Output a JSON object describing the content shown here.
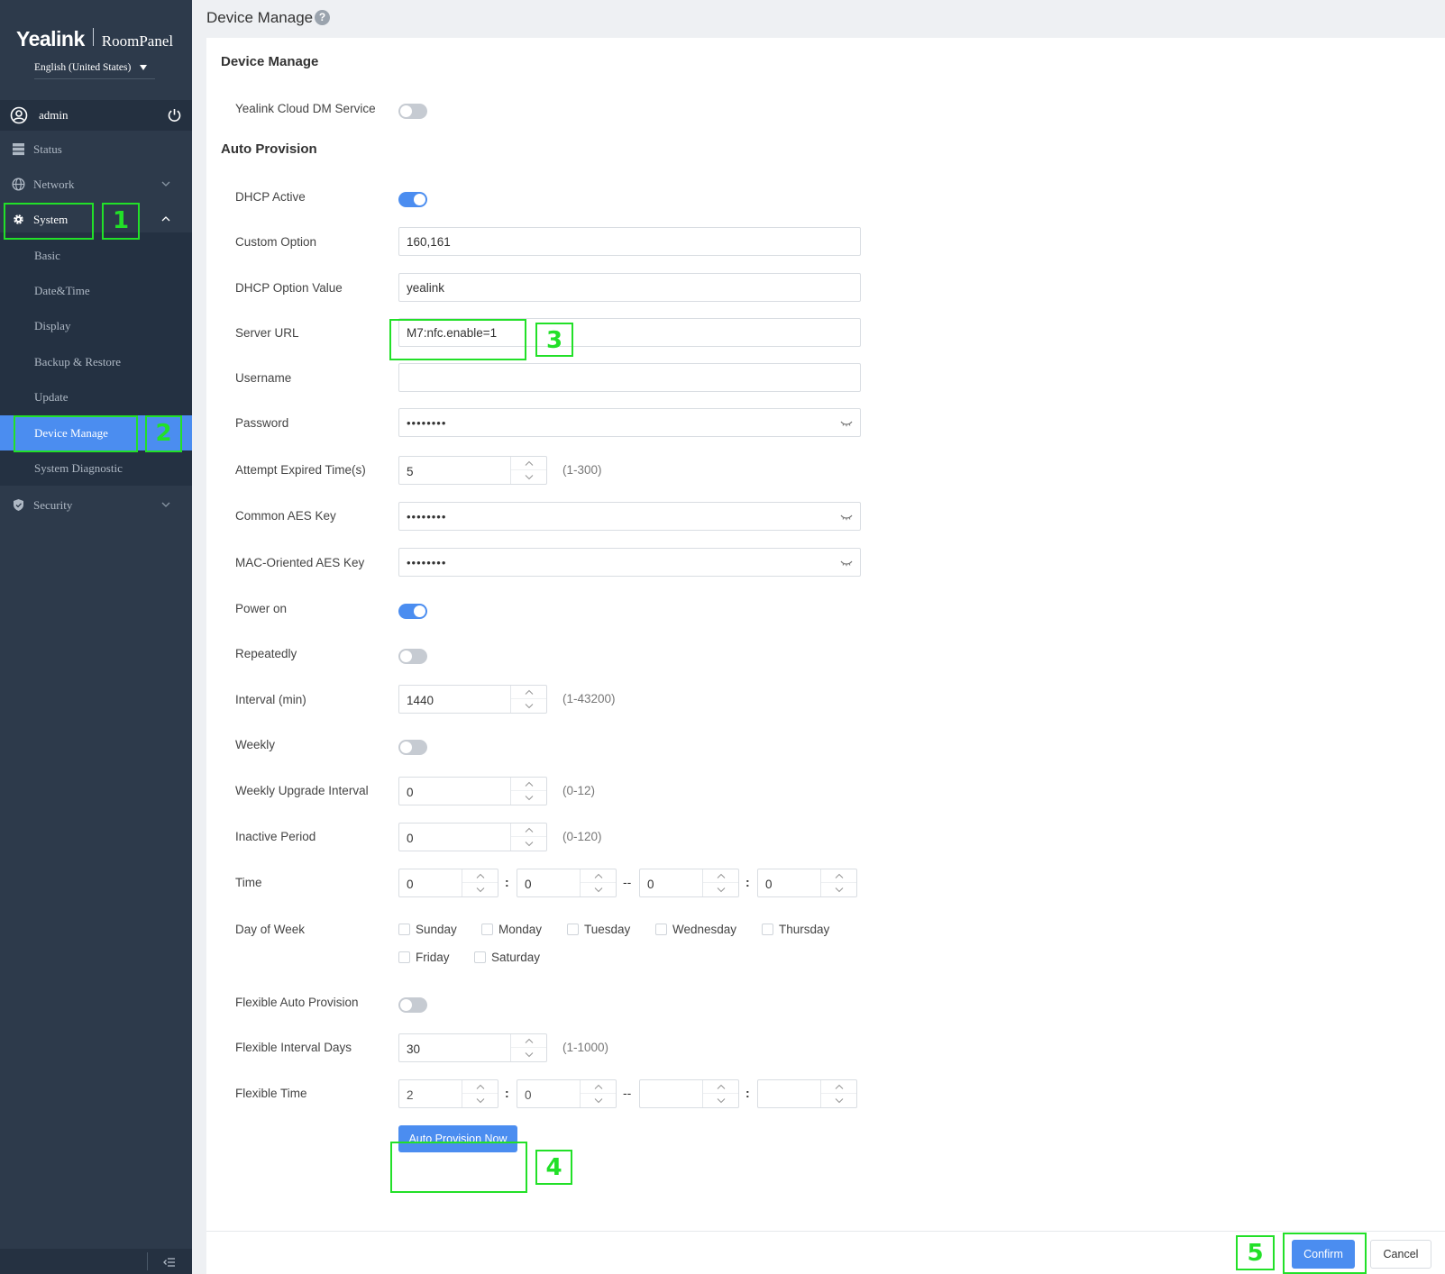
{
  "brand": {
    "logo": "Yealink",
    "product": "RoomPanel"
  },
  "language": {
    "selected": "English (United States)"
  },
  "user": {
    "name": "admin"
  },
  "sidebar": {
    "items": [
      {
        "label": "Status",
        "icon": "server-icon"
      },
      {
        "label": "Network",
        "icon": "globe-icon"
      },
      {
        "label": "System",
        "icon": "gear-icon"
      },
      {
        "label": "Security",
        "icon": "shield-icon"
      }
    ],
    "system_sub": [
      {
        "label": "Basic"
      },
      {
        "label": "Date&Time"
      },
      {
        "label": "Display"
      },
      {
        "label": "Backup & Restore"
      },
      {
        "label": "Update"
      },
      {
        "label": "Device Manage",
        "selected": true
      },
      {
        "label": "System Diagnostic"
      }
    ]
  },
  "header": {
    "title": "Device Manage",
    "help": "?"
  },
  "device_manage": {
    "section_title": "Device Manage",
    "cloud_dm_label": "Yealink Cloud DM Service",
    "cloud_dm_on": false
  },
  "auto_provision": {
    "section_title": "Auto Provision",
    "dhcp_active_label": "DHCP Active",
    "dhcp_active_on": true,
    "custom_option_label": "Custom Option",
    "custom_option_value": "160,161",
    "dhcp_option_value_label": "DHCP Option Value",
    "dhcp_option_value": "yealink",
    "server_url_label": "Server URL",
    "server_url_value": "M7:nfc.enable=1",
    "username_label": "Username",
    "username_value": "",
    "password_label": "Password",
    "password_mask": "••••••••",
    "attempt_label": "Attempt Expired Time(s)",
    "attempt_value": "5",
    "attempt_range": "(1-300)",
    "common_aes_label": "Common AES Key",
    "common_aes_mask": "••••••••",
    "mac_aes_label": "MAC-Oriented AES Key",
    "mac_aes_mask": "••••••••",
    "power_on_label": "Power on",
    "power_on_on": true,
    "repeatedly_label": "Repeatedly",
    "repeatedly_on": false,
    "interval_label": "Interval (min)",
    "interval_value": "1440",
    "interval_range": "(1-43200)",
    "weekly_label": "Weekly",
    "weekly_on": false,
    "weekly_upgrade_label": "Weekly Upgrade Interval",
    "weekly_upgrade_value": "0",
    "weekly_upgrade_range": "(0-12)",
    "inactive_label": "Inactive Period",
    "inactive_value": "0",
    "inactive_range": "(0-120)",
    "time_label": "Time",
    "time_values": [
      "0",
      "0",
      "0",
      "0"
    ],
    "time_colon": ":",
    "time_dash": "--",
    "day_of_week_label": "Day of Week",
    "days": [
      "Sunday",
      "Monday",
      "Tuesday",
      "Wednesday",
      "Thursday",
      "Friday",
      "Saturday"
    ],
    "flexible_label": "Flexible Auto Provision",
    "flexible_on": false,
    "flex_interval_label": "Flexible Interval Days",
    "flex_interval_value": "30",
    "flex_interval_range": "(1-1000)",
    "flex_time_label": "Flexible Time",
    "flex_time_values": [
      "2",
      "0",
      "",
      ""
    ],
    "auto_provision_now_label": "Auto Provision Now"
  },
  "footer": {
    "confirm_label": "Confirm",
    "cancel_label": "Cancel"
  },
  "annotations": [
    "1",
    "2",
    "3",
    "4",
    "5"
  ],
  "colors": {
    "sidebar": "#2d3a4b",
    "accent": "#4b8df0",
    "annotation": "#22e028"
  }
}
